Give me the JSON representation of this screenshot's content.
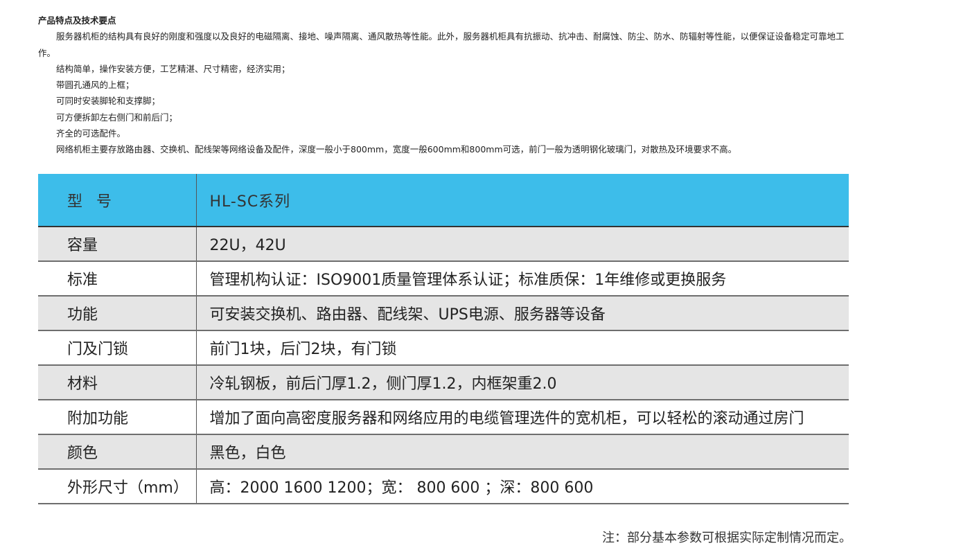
{
  "intro": {
    "heading": "产品特点及技术要点",
    "paragraph": "服务器机柜的结构具有良好的刚度和强度以及良好的电磁隔离、接地、噪声隔离、通风散热等性能。此外，服务器机柜具有抗振动、抗冲击、耐腐蚀、防尘、防水、防辐射等性能，以便保证设备稳定可靠地工作。",
    "bullets": [
      "结构简单，操作安装方便，工艺精湛、尺寸精密，经济实用；",
      "带圆孔通风的上框；",
      "可同时安装脚轮和支撑脚；",
      "可方便拆卸左右侧门和前后门；",
      "齐全的可选配件。",
      "网络机柜主要存放路由器、交换机、配线架等网络设备及配件，深度一般小于800mm，宽度一般600mm和800mm可选，前门一般为透明钢化玻璃门，对散热及环境要求不高。"
    ]
  },
  "table": {
    "header": {
      "label": "型号",
      "value": "HL-SC系列"
    },
    "rows": [
      {
        "label": "容量",
        "value": "22U，42U"
      },
      {
        "label": "标准",
        "value": "管理机构认证：ISO9001质量管理体系认证；标准质保：1年维修或更换服务"
      },
      {
        "label": "功能",
        "value": "可安装交换机、路由器、配线架、UPS电源、服务器等设备"
      },
      {
        "label": "门及门锁",
        "value": "前门1块，后门2块，有门锁"
      },
      {
        "label": "材料",
        "value": "冷轧钢板，前后门厚1.2，侧门厚1.2，内框架重2.0"
      },
      {
        "label": "附加功能",
        "value": "增加了面向高密度服务器和网络应用的电缆管理选件的宽机柜，可以轻松的滚动通过房门"
      },
      {
        "label": "颜色",
        "value": "黑色，白色"
      },
      {
        "label": "外形尺寸（mm）",
        "value": "高：2000 1600 1200；宽： 800 600 ；深：800 600"
      }
    ]
  },
  "note": "注：部分基本参数可根据实际定制情况而定。",
  "colors": {
    "header_bg": "#3dbdea",
    "shaded_row_bg": "#e5e5e5"
  }
}
